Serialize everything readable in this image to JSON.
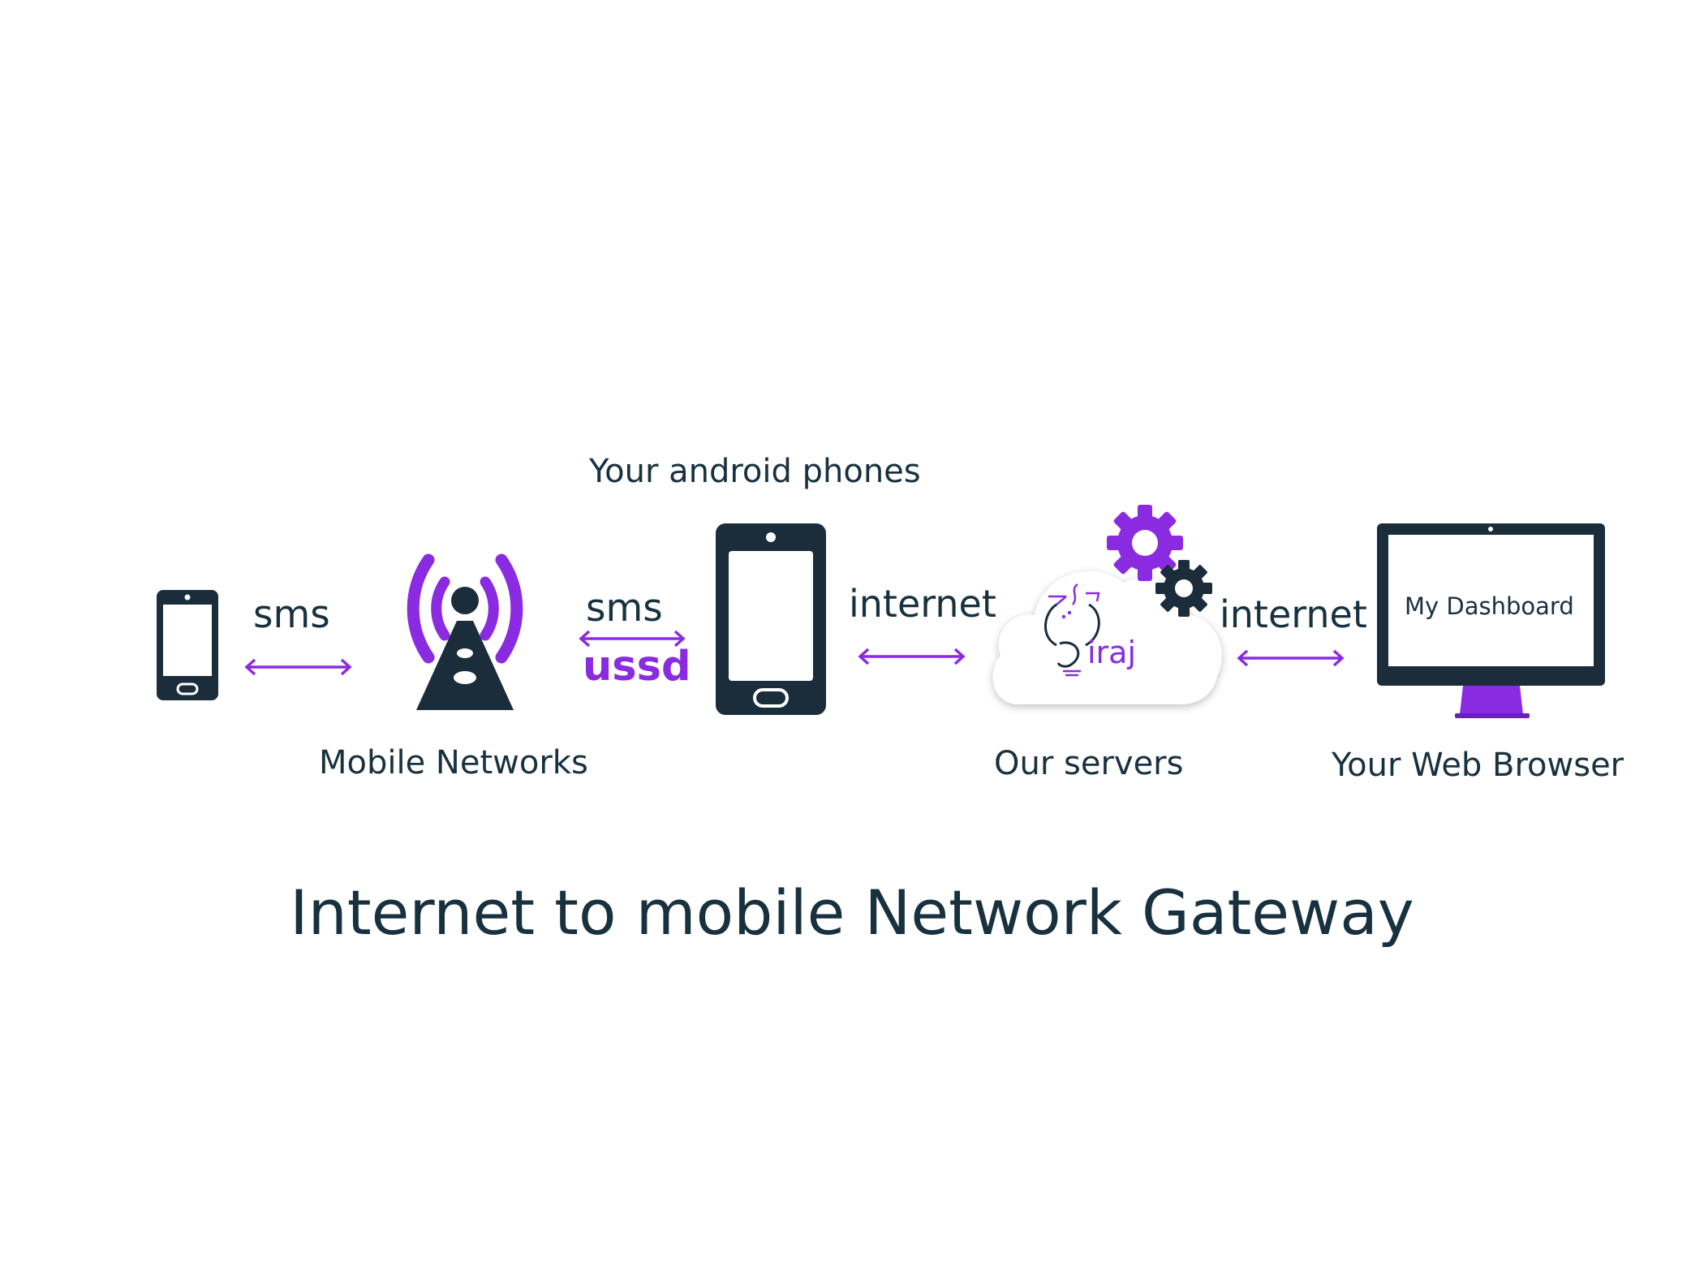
{
  "diagram": {
    "title": "Internet to mobile Network Gateway",
    "colors": {
      "dark": "#1b2d3b",
      "purple": "#8a2be2",
      "text": "#18313f"
    },
    "nodes": {
      "phone": {
        "icon": "smartphone-icon"
      },
      "tower": {
        "icon": "cell-tower-icon",
        "label": "Mobile Networks"
      },
      "android": {
        "icon": "smartphone-icon",
        "label": "Your android phones"
      },
      "servers": {
        "icon": "cloud-gears-icon",
        "label": "Our servers",
        "logo_text": "Siraj"
      },
      "browser": {
        "icon": "monitor-icon",
        "label": "Your Web Browser",
        "screen_text": "My Dashboard"
      }
    },
    "links": {
      "phone_tower": {
        "label": "sms"
      },
      "tower_android": {
        "label": "sms",
        "label2": "ussd"
      },
      "android_servers": {
        "label": "internet"
      },
      "servers_browser": {
        "label": "internet"
      }
    }
  }
}
